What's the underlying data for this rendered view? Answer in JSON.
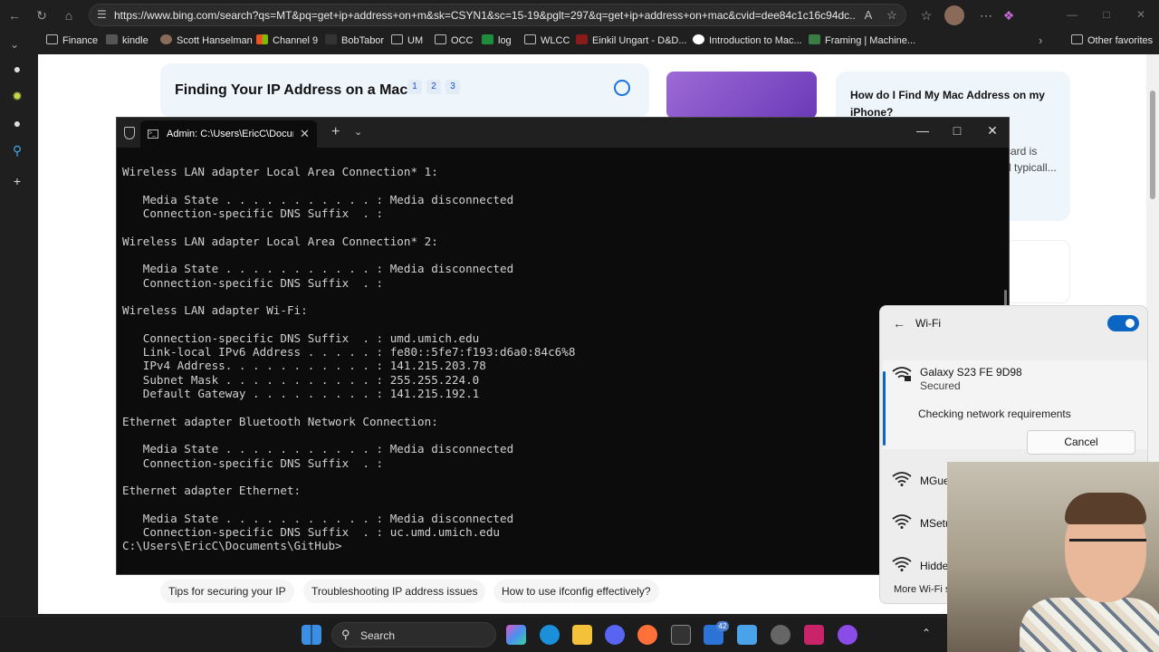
{
  "browser": {
    "url": "https://www.bing.com/search?qs=MT&pq=get+ip+address+on+m&sk=CSYN1&sc=15-19&pglt=297&q=get+ip+address+on+mac&cvid=dee84c1c16c94dc...",
    "bookmarks": [
      {
        "label": "Finance"
      },
      {
        "label": "kindle"
      },
      {
        "label": "Scott Hanselman"
      },
      {
        "label": "Channel 9"
      },
      {
        "label": "BobTabor"
      },
      {
        "label": "UM"
      },
      {
        "label": "OCC"
      },
      {
        "label": "log"
      },
      {
        "label": "WLCC"
      },
      {
        "label": "Einkil Ungart - D&D..."
      },
      {
        "label": "Introduction to Mac..."
      },
      {
        "label": "Framing | Machine..."
      }
    ],
    "other_favorites": "Other favorites"
  },
  "page": {
    "card_title": "Finding Your IP Address on a Mac",
    "citations": [
      "1",
      "2",
      "3"
    ],
    "question_title": "How do I Find My Mac Address on my iPhone?",
    "question_snippet_1": "card is",
    "question_snippet_2": "d typicall...",
    "related_chips": [
      "Tips for securing your IP",
      "Troubleshooting IP address issues",
      "How to use ifconfig effectively?"
    ]
  },
  "terminal": {
    "tab_title": "Admin: C:\\Users\\EricC\\Documents\\GitHub",
    "lines": [
      "",
      "Wireless LAN adapter Local Area Connection* 1:",
      "",
      "   Media State . . . . . . . . . . . : Media disconnected",
      "   Connection-specific DNS Suffix  . :",
      "",
      "Wireless LAN adapter Local Area Connection* 2:",
      "",
      "   Media State . . . . . . . . . . . : Media disconnected",
      "   Connection-specific DNS Suffix  . :",
      "",
      "Wireless LAN adapter Wi-Fi:",
      "",
      "   Connection-specific DNS Suffix  . : umd.umich.edu",
      "   Link-local IPv6 Address . . . . . : fe80::5fe7:f193:d6a0:84c6%8",
      "   IPv4 Address. . . . . . . . . . . : 141.215.203.78",
      "   Subnet Mask . . . . . . . . . . . : 255.255.224.0",
      "   Default Gateway . . . . . . . . . : 141.215.192.1",
      "",
      "Ethernet adapter Bluetooth Network Connection:",
      "",
      "   Media State . . . . . . . . . . . : Media disconnected",
      "   Connection-specific DNS Suffix  . :",
      "",
      "Ethernet adapter Ethernet:",
      "",
      "   Media State . . . . . . . . . . . : Media disconnected",
      "   Connection-specific DNS Suffix  . : uc.umd.umich.edu",
      "C:\\Users\\EricC\\Documents\\GitHub>"
    ]
  },
  "wifi": {
    "title": "Wi-Fi",
    "toggle_on": true,
    "active_network": {
      "name": "Galaxy S23 FE 9D98",
      "status": "Secured",
      "checking": "Checking network requirements",
      "cancel": "Cancel"
    },
    "other_networks": [
      "MGue",
      "MSetu",
      "Hidde"
    ],
    "more_settings": "More Wi-Fi se"
  },
  "taskbar": {
    "search_label": "Search",
    "badge_count": "42"
  },
  "colors": {
    "accent": "#0a66c2",
    "terminal_bg": "#0c0c0c",
    "page_bg": "#ffffff"
  }
}
